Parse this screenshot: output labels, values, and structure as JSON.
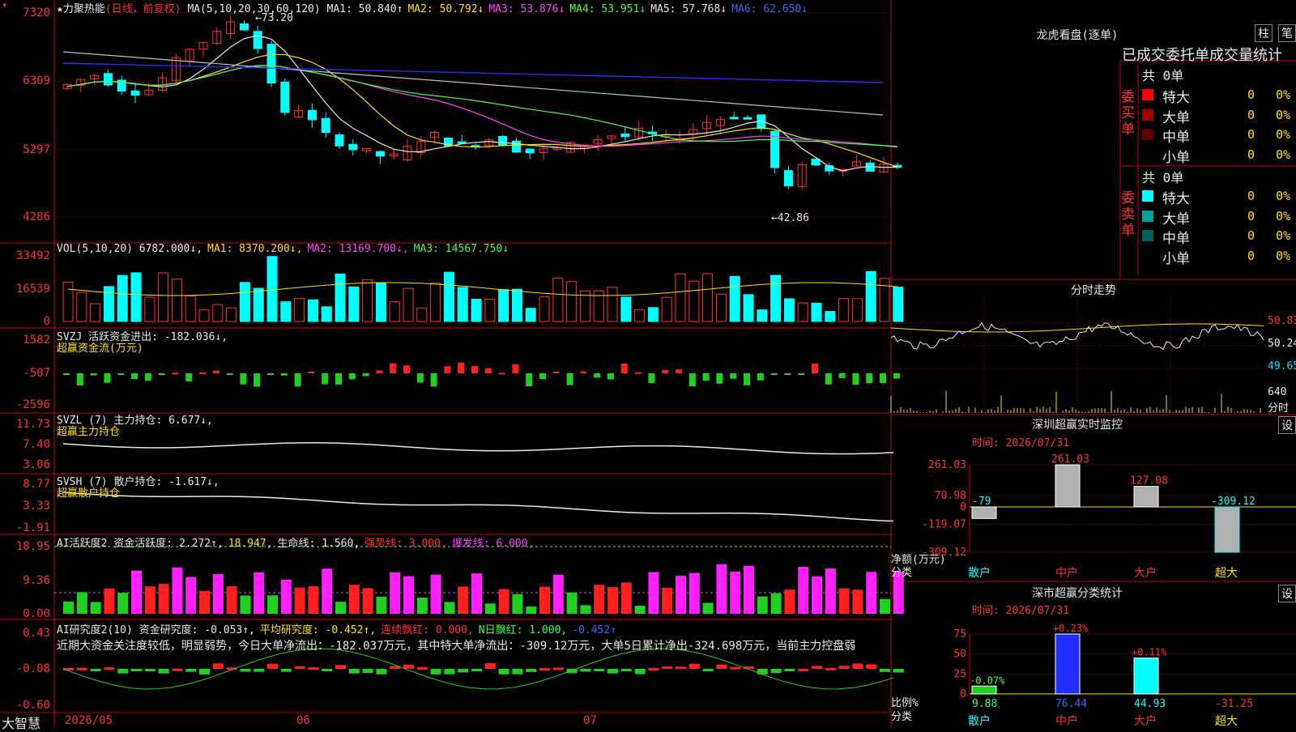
{
  "stock": {
    "name": "★力聚热能",
    "mode": "(日线，前复权)"
  },
  "ma_line": {
    "label": "MA(5,10,20,30,60,120)",
    "items": [
      {
        "t": "MA1: 50.840↑",
        "color": "#e8e8e8"
      },
      {
        "t": "MA2: 50.792↓",
        "color": "#ffe000"
      },
      {
        "t": "MA3: 53.876↓",
        "color": "#ff40ff"
      },
      {
        "t": "MA4: 53.951↓",
        "color": "#40ff40"
      },
      {
        "t": "MA5: 57.768↓",
        "color": "#e8e8e8"
      },
      {
        "t": "MA6: 62.650↓",
        "color": "#4060ff"
      }
    ]
  },
  "price_axis": [
    "7320",
    "6309",
    "5297",
    "4286"
  ],
  "price_annotations": {
    "high": "73.20",
    "low": "42.86"
  },
  "vol_line": {
    "label": "VOL(5,10,20)",
    "items": [
      {
        "t": "6782.000↓,",
        "color": "#e8e8e8"
      },
      {
        "t": "MA1: 8370.200↓,",
        "color": "#ffe000"
      },
      {
        "t": "MA2: 13169.700↓,",
        "color": "#ff40ff"
      },
      {
        "t": "MA3: 14567.750↓",
        "color": "#40ff40"
      }
    ]
  },
  "vol_axis": [
    "33492",
    "16539",
    "0"
  ],
  "svzj": {
    "label": "SVZJ  活跃资金进出: -182.036↓,",
    "sub": "超赢资金流(万元)",
    "axis": [
      "1582",
      "-507",
      "-2596"
    ]
  },
  "svzl": {
    "label": "SVZL (7) 主力持仓: 6.677↓,",
    "sub": "超赢主力持仓",
    "axis": [
      "11.73",
      "7.40",
      "3.06"
    ]
  },
  "svsh": {
    "label": "SVSH (7) 散户持仓: -1.617↓,",
    "sub": "超赢散户持仓",
    "axis": [
      "8.77",
      "3.33",
      "-1.91"
    ]
  },
  "ai_active": {
    "items": [
      {
        "t": "AI活跃度2 资金活跃度: 2.272↑,",
        "color": "#e8e8e8"
      },
      {
        "t": "18.947,",
        "color": "#ffe000"
      },
      {
        "t": "生命线: 1.560,",
        "color": "#e8e8e8"
      },
      {
        "t": "强势线: 3.000,",
        "color": "#ff3030"
      },
      {
        "t": "爆发线: 6.000,",
        "color": "#ff40ff"
      }
    ],
    "axis": [
      "18.95",
      "9.36",
      "0.00"
    ]
  },
  "ai_research": {
    "items": [
      {
        "t": "AI研究度2(10) 资金研究度: -0.053↑,",
        "color": "#e8e8e8"
      },
      {
        "t": "平均研究度: -0.452↑,",
        "color": "#ffe000"
      },
      {
        "t": "连续飘红: 0.000,",
        "color": "#ff3030"
      },
      {
        "t": "N日飘红: 1.000,",
        "color": "#40ff40"
      },
      {
        "t": "-0.452↑",
        "color": "#4060ff"
      }
    ],
    "summary": "近期大资金关注度较低，明显弱势，今日大单净流出：-182.037万元，其中特大单净流出：-309.12万元，大单5日累计净出-324.698万元，当前主力控盘弱",
    "axis": [
      "0.43",
      "-0.08",
      "-0.60"
    ]
  },
  "x_axis": {
    "left_label": "大智慧",
    "labels": [
      "2026/05",
      "06",
      "07"
    ]
  },
  "right_panel": {
    "title": "龙虎看盘(逐单)",
    "btn1": "柱",
    "btn2": "笔",
    "subtitle": "已成交委托单成交量统计",
    "buy_label": "委买单",
    "sell_label": "委卖单",
    "buy_total": "共 0单",
    "sell_total": "共 0单",
    "buy_rows": [
      {
        "name": "特大",
        "val": "0",
        "pct": "0%",
        "color": "#ff0000"
      },
      {
        "name": "大单",
        "val": "0",
        "pct": "0%",
        "color": "#a00000"
      },
      {
        "name": "中单",
        "val": "0",
        "pct": "0%",
        "color": "#600000"
      },
      {
        "name": "小单",
        "val": "0",
        "pct": "0%",
        "color": "#000000"
      }
    ],
    "sell_rows": [
      {
        "name": "特大",
        "val": "0",
        "pct": "0%",
        "color": "#00ffff"
      },
      {
        "name": "大单",
        "val": "0",
        "pct": "0%",
        "color": "#00a0a0"
      },
      {
        "name": "中单",
        "val": "0",
        "pct": "0%",
        "color": "#006060"
      },
      {
        "name": "小单",
        "val": "0",
        "pct": "0%",
        "color": "#000000"
      }
    ]
  },
  "intraday": {
    "title": "分时走势",
    "right_axis": [
      "50.83",
      "50.24",
      "49.65"
    ],
    "vol_axis": [
      "640",
      "分时"
    ]
  },
  "monitor": {
    "title": "深圳超赢实时监控",
    "btn": "设",
    "time": "时间: 2026/07/31",
    "axis": [
      "261.03",
      "70.98",
      "0",
      "-119.07",
      "-309.12"
    ],
    "ylabel": "净额(万元)",
    "xlabel": "分类"
  },
  "classify": {
    "title": "深市超赢分类统计",
    "btn": "设",
    "time": "时间: 2026/07/31",
    "axis": [
      "75",
      "50",
      "25",
      "0"
    ],
    "ylabel": "比例%",
    "xlabel": "分类"
  },
  "chart_data": [
    {
      "type": "bar",
      "title": "深圳超赢实时监控",
      "ylabel": "净额(万元)",
      "xlabel": "分类",
      "categories": [
        "散户",
        "中户",
        "大户",
        "超大"
      ],
      "values": [
        -79,
        261.03,
        127.08,
        -309.12
      ],
      "labels": [
        "-79",
        "261.03",
        "127.08",
        "-309.12"
      ],
      "ylim": [
        -309.12,
        261.03
      ]
    },
    {
      "type": "bar",
      "title": "深市超赢分类统计",
      "ylabel": "比例%",
      "xlabel": "分类",
      "categories": [
        "散户",
        "中户",
        "大户",
        "超大"
      ],
      "values": [
        9.88,
        76.44,
        44.93,
        -31.25
      ],
      "changes": [
        "-0.07%",
        "+0.23%",
        "+0.11%",
        ""
      ],
      "value_labels": [
        "9.88",
        "76.44",
        "44.93",
        "-31.25"
      ],
      "ylim": [
        0,
        75
      ]
    }
  ]
}
